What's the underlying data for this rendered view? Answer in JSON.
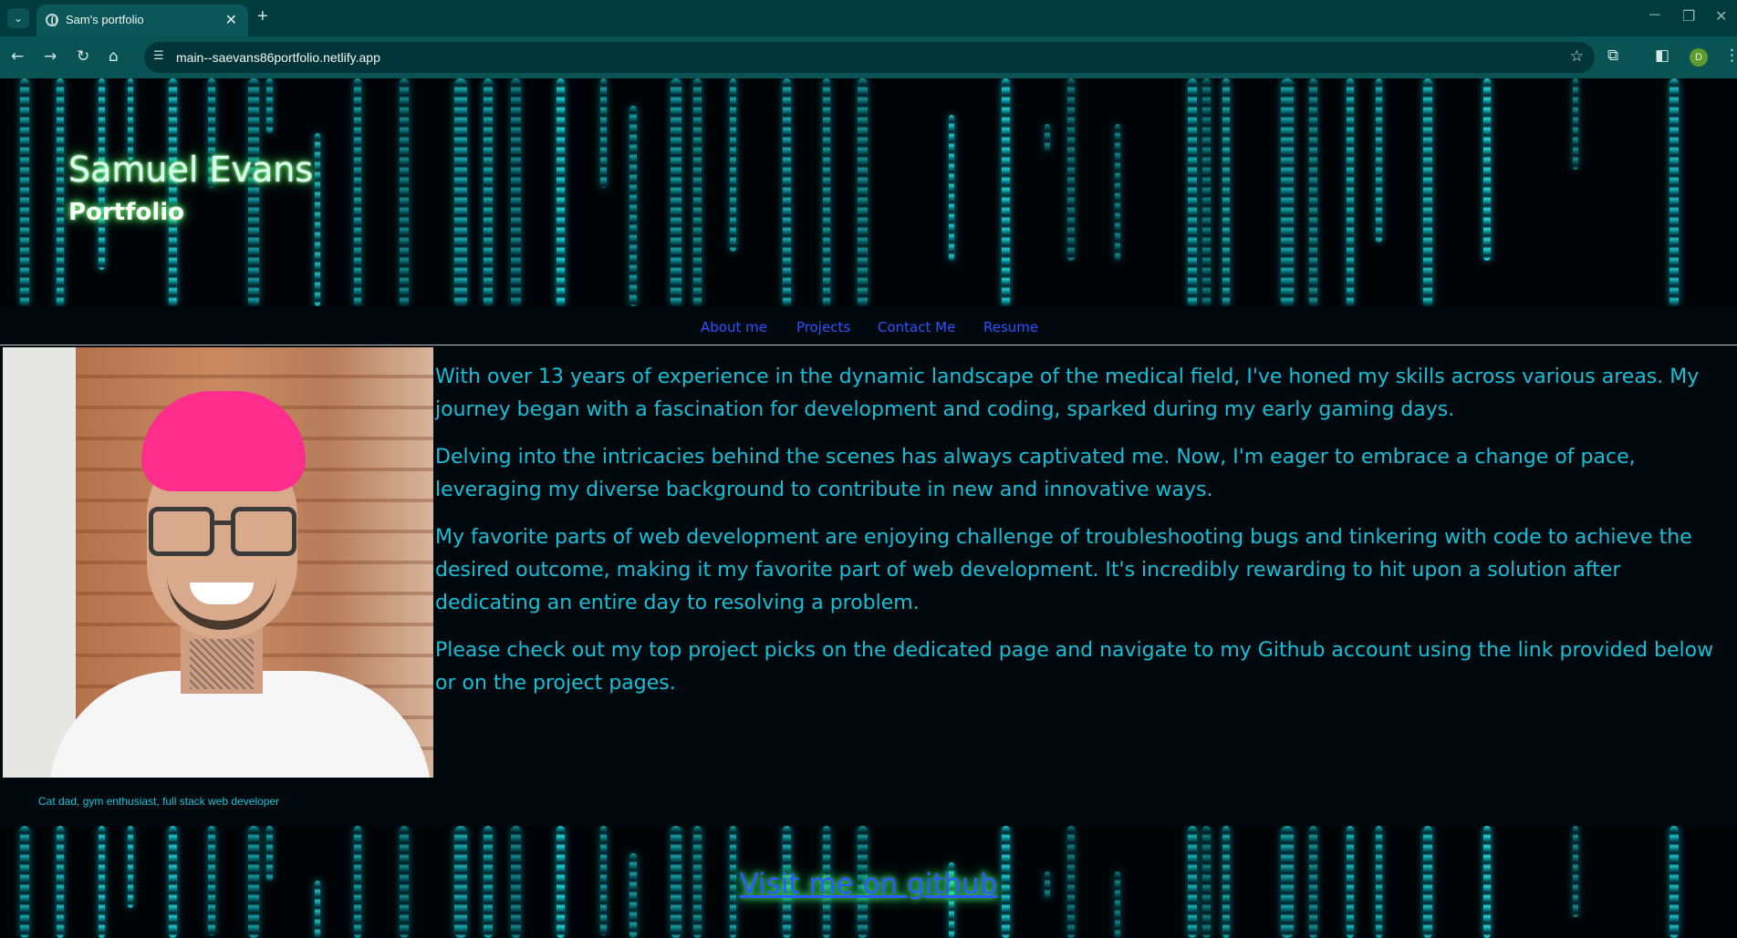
{
  "browser": {
    "tab_title": "Sam's portfolio",
    "tab_close": "✕",
    "new_tab": "+",
    "url": "main--saevans86portfolio.netlify.app",
    "profile_initial": "D",
    "icons": {
      "tab_search": "chevron-down-icon",
      "back": "back-arrow-icon",
      "forward": "forward-arrow-icon",
      "reload": "reload-icon",
      "home": "home-icon",
      "site_info": "site-settings-icon",
      "bookmark": "star-icon",
      "extensions": "puzzle-icon",
      "side_panel": "side-panel-icon",
      "menu": "kebab-menu-icon",
      "minimize": "minimize-icon",
      "restore": "restore-icon",
      "close": "close-icon"
    }
  },
  "header": {
    "title": "Samuel Evans",
    "subtitle": "Portfolio"
  },
  "nav": {
    "items": [
      {
        "label": "About me"
      },
      {
        "label": "Projects"
      },
      {
        "label": "Contact Me"
      },
      {
        "label": "Resume"
      }
    ]
  },
  "profile": {
    "caption": "Cat dad, gym enthusiast, full stack web developer"
  },
  "about": {
    "paragraphs": [
      "With over 13 years of experience in the dynamic landscape of the medical field, I've honed my skills across various areas. My journey began with a fascination for development and coding, sparked during my early gaming days.",
      "Delving into the intricacies behind the scenes has always captivated me. Now, I'm eager to embrace a change of pace, leveraging my diverse background to contribute in new and innovative ways.",
      "My favorite parts of web development are enjoying challenge of troubleshooting bugs and tinkering with code to achieve the desired outcome, making it my favorite part of web development. It's incredibly rewarding to hit upon a solution after dedicating an entire day to resolving a problem.",
      "Please check out my top project picks on the dedicated page and navigate to my Github account using the link provided below or on the project pages."
    ]
  },
  "footer": {
    "github_link": "Visit me on github"
  },
  "colors": {
    "page_bg": "#01090f",
    "text_cyan": "#17bfd6",
    "link_blue": "#2a54ff",
    "glow_green": "#45ff6a",
    "chrome_dark": "#023b3e",
    "chrome_toolbar": "#0a5355"
  }
}
